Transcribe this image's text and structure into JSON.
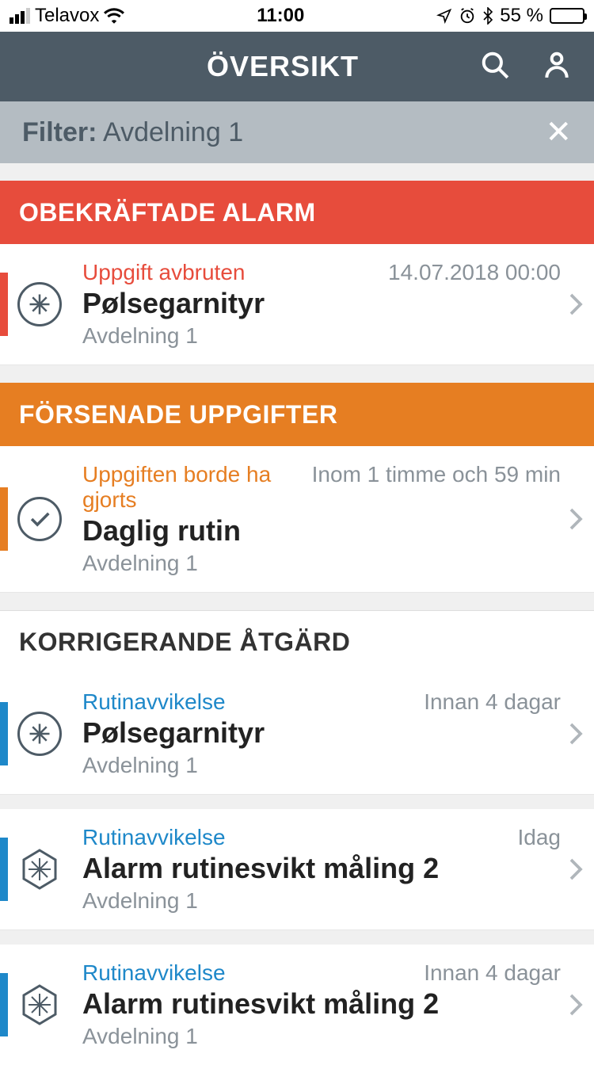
{
  "status": {
    "carrier": "Telavox",
    "time": "11:00",
    "battery_pct": "55 %"
  },
  "header": {
    "title": "ÖVERSIKT"
  },
  "filter": {
    "label": "Filter:",
    "value": "Avdelning 1"
  },
  "sections": {
    "unconfirmed": {
      "heading": "OBEKRÄFTADE ALARM",
      "items": [
        {
          "tag": "Uppgift avbruten",
          "time": "14.07.2018 00:00",
          "title": "Pølsegarnityr",
          "sub": "Avdelning 1"
        }
      ]
    },
    "overdue": {
      "heading": "FÖRSENADE UPPGIFTER",
      "items": [
        {
          "tag": "Uppgiften borde ha gjorts",
          "time": "Inom 1 timme och 59 min",
          "title": "Daglig rutin",
          "sub": "Avdelning 1"
        }
      ]
    },
    "corrective": {
      "heading": "KORRIGERANDE ÅTGÄRD",
      "items": [
        {
          "tag": "Rutinavvikelse",
          "time": "Innan 4 dagar",
          "title": "Pølsegarnityr",
          "sub": "Avdelning 1"
        },
        {
          "tag": "Rutinavvikelse",
          "time": "Idag",
          "title": "Alarm rutinesvikt måling 2",
          "sub": "Avdelning 1"
        },
        {
          "tag": "Rutinavvikelse",
          "time": "Innan 4 dagar",
          "title": "Alarm rutinesvikt måling 2",
          "sub": "Avdelning 1"
        }
      ]
    }
  }
}
